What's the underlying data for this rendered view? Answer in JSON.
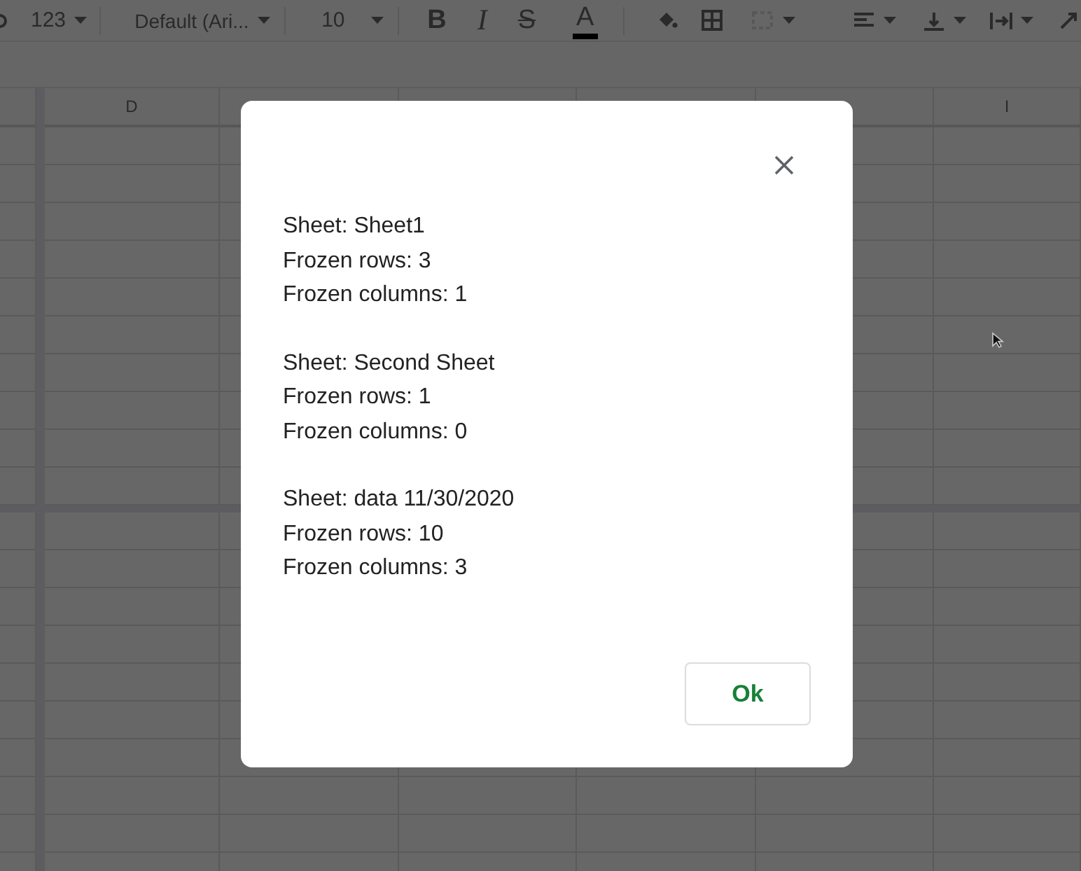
{
  "toolbar": {
    "number_format": "123",
    "font": "Default (Ari...",
    "font_size": "10",
    "bold": "B",
    "italic": "I",
    "strike": "S",
    "text_color": "A"
  },
  "grid": {
    "column_headers": [
      "D",
      "I"
    ]
  },
  "dialog": {
    "message_blocks": [
      [
        "Sheet: Sheet1",
        "Frozen rows: 3",
        "Frozen columns: 1"
      ],
      [
        "Sheet: Second Sheet",
        "Frozen rows: 1",
        "Frozen columns: 0"
      ],
      [
        "Sheet: data 11/30/2020",
        "Frozen rows: 10",
        "Frozen columns: 3"
      ]
    ],
    "ok_button": "Ok"
  }
}
